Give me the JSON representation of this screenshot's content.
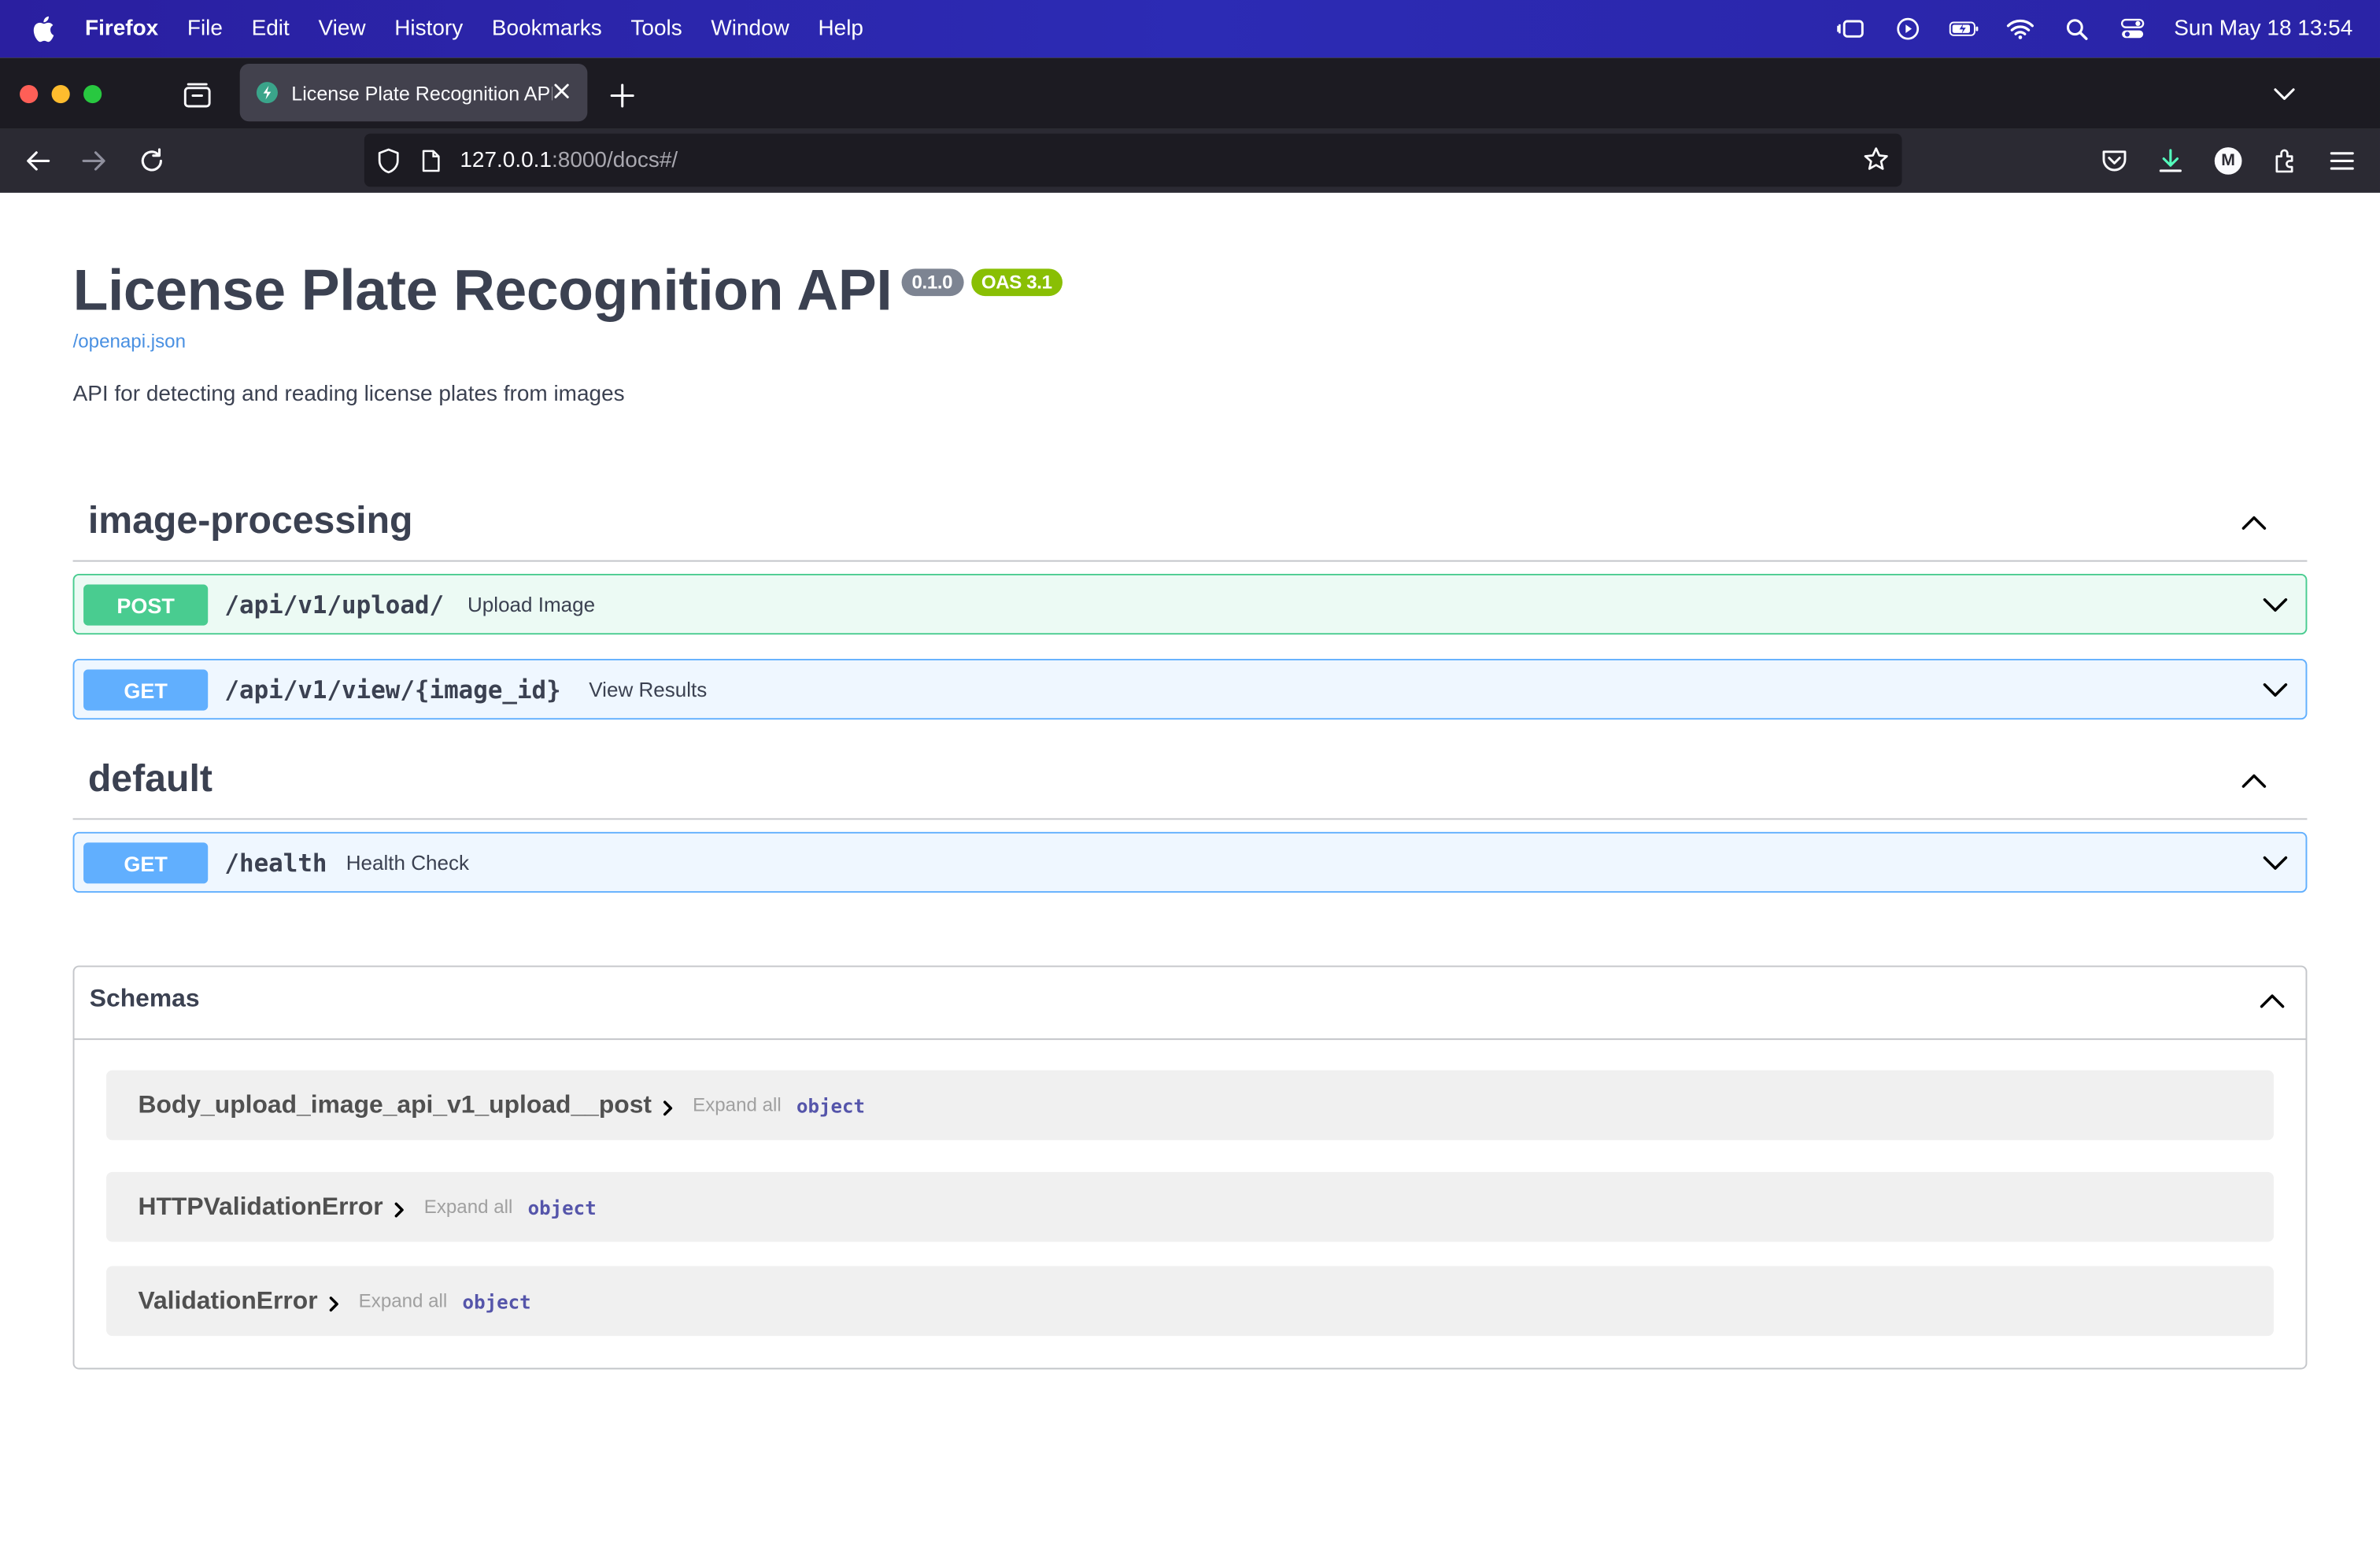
{
  "menubar": {
    "app_name": "Firefox",
    "items": [
      "File",
      "Edit",
      "View",
      "History",
      "Bookmarks",
      "Tools",
      "Window",
      "Help"
    ],
    "clock": "Sun May 18  13:54"
  },
  "browser": {
    "tab_title": "License Plate Recognition API -",
    "url_host": "127.0.0.1",
    "url_rest": ":8000/docs#/",
    "avatar_letter": "M"
  },
  "page": {
    "title": "License Plate Recognition API",
    "version_badge": "0.1.0",
    "oas_badge": "OAS 3.1",
    "spec_link": "/openapi.json",
    "description": "API for detecting and reading license plates from images",
    "tags": [
      {
        "name": "image-processing",
        "operations": [
          {
            "method": "POST",
            "path": "/api/v1/upload/",
            "summary": "Upload Image"
          },
          {
            "method": "GET",
            "path": "/api/v1/view/{image_id}",
            "summary": "View Results"
          }
        ]
      },
      {
        "name": "default",
        "operations": [
          {
            "method": "GET",
            "path": "/health",
            "summary": "Health Check"
          }
        ]
      }
    ],
    "schemas": {
      "label": "Schemas",
      "expand_label": "Expand all",
      "models": [
        {
          "name": "Body_upload_image_api_v1_upload__post",
          "type": "object"
        },
        {
          "name": "HTTPValidationError",
          "type": "object"
        },
        {
          "name": "ValidationError",
          "type": "object"
        }
      ]
    }
  },
  "colors": {
    "post": "#49cc90",
    "get": "#61affe",
    "version_badge": "#7d8492",
    "oas_badge": "#89bf04",
    "link": "#4990e2"
  }
}
